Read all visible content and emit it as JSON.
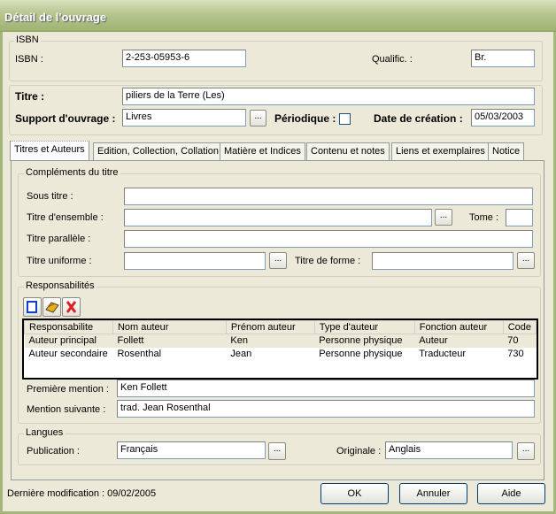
{
  "window": {
    "title": "Détail de l'ouvrage"
  },
  "isbn_group": {
    "legend": "ISBN",
    "isbn_label": "ISBN :",
    "isbn_value": "2-253-05953-6",
    "qualific_label": "Qualific. :",
    "qualific_value": "Br."
  },
  "main_group": {
    "titre_label": "Titre :",
    "titre_value": "piliers de la Terre (Les)",
    "support_label": "Support d'ouvrage :",
    "support_value": "Livres",
    "browse": "...",
    "periodique_label": "Périodique :",
    "periodique_checked": false,
    "date_label": "Date de création :",
    "date_value": "05/03/2003"
  },
  "tabs": [
    {
      "label": "Titres et Auteurs",
      "active": true
    },
    {
      "label": "Edition, Collection, Collation"
    },
    {
      "label": "Matière et Indices"
    },
    {
      "label": "Contenu et notes"
    },
    {
      "label": "Liens et exemplaires"
    },
    {
      "label": "Notice"
    }
  ],
  "complements": {
    "legend": "Compléments du titre",
    "sous_titre_label": "Sous titre :",
    "sous_titre_value": "",
    "ensemble_label": "Titre d'ensemble :",
    "ensemble_value": "",
    "tome_label": "Tome :",
    "tome_value": "",
    "parallele_label": "Titre parallèle :",
    "parallele_value": "",
    "uniforme_label": "Titre uniforme :",
    "uniforme_value": "",
    "forme_label": "Titre de forme :",
    "forme_value": ""
  },
  "responsabilites": {
    "legend": "Responsabilités",
    "toolbar": [
      "new-icon",
      "edit-icon",
      "delete-icon"
    ],
    "columns": [
      "Responsabilite",
      "Nom auteur",
      "Prénom auteur",
      "Type d'auteur",
      "Fonction auteur",
      "Code"
    ],
    "rows": [
      [
        "Auteur principal",
        "Follett",
        "Ken",
        "Personne physique",
        "Auteur",
        "70"
      ],
      [
        "Auteur secondaire",
        "Rosenthal",
        "Jean",
        "Personne physique",
        "Traducteur",
        "730"
      ]
    ],
    "premiere_label": "Première mention :",
    "premiere_value": "Ken Follett",
    "suivante_label": "Mention suivante :",
    "suivante_value": "trad. Jean Rosenthal"
  },
  "langues": {
    "legend": "Langues",
    "publication_label": "Publication :",
    "publication_value": "Français",
    "originale_label": "Originale :",
    "originale_value": "Anglais"
  },
  "footer": {
    "last_modified": "Dernière modification : 09/02/2005",
    "ok": "OK",
    "cancel": "Annuler",
    "help": "Aide"
  }
}
